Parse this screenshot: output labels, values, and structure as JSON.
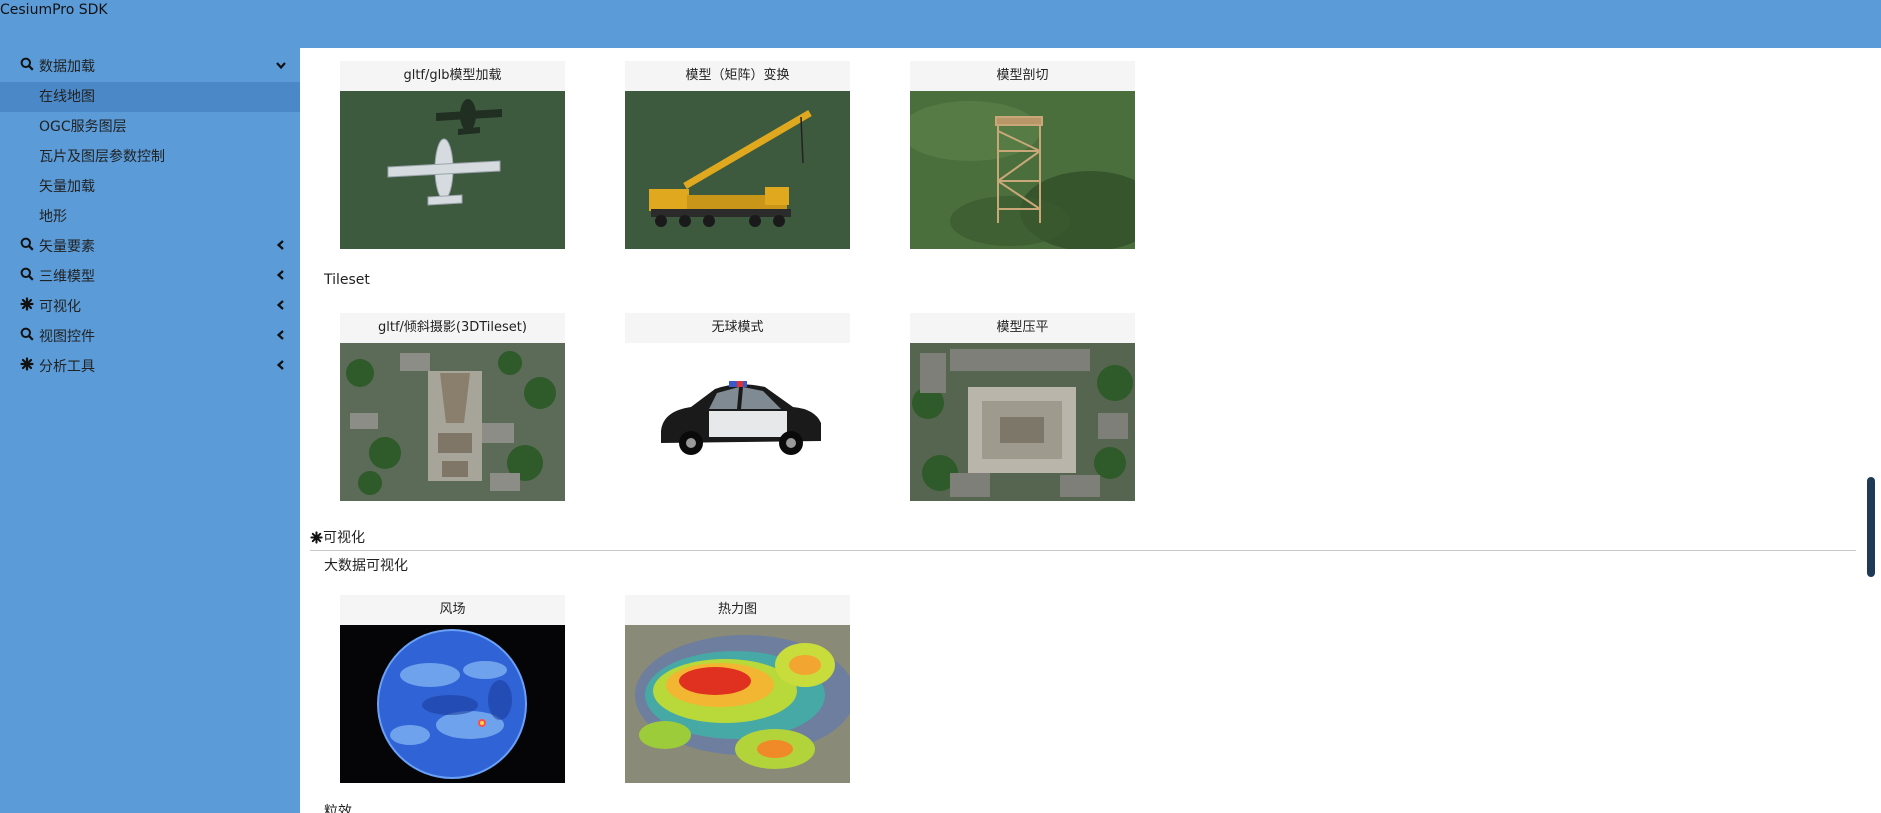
{
  "app": {
    "title": "CesiumPro SDK"
  },
  "sidebar": {
    "groups": [
      {
        "label": "数据加载",
        "icon": "search-icon",
        "expanded": true,
        "items": [
          "在线地图",
          "OGC服务图层",
          "瓦片及图层参数控制",
          "矢量加载",
          "地形"
        ]
      },
      {
        "label": "矢量要素",
        "icon": "search-icon",
        "expanded": false
      },
      {
        "label": "三维模型",
        "icon": "search-icon",
        "expanded": false
      },
      {
        "label": "可视化",
        "icon": "gear-icon",
        "expanded": false
      },
      {
        "label": "视图控件",
        "icon": "search-icon",
        "expanded": false
      },
      {
        "label": "分析工具",
        "icon": "gear-icon",
        "expanded": false
      }
    ],
    "active_item": "在线地图"
  },
  "main": {
    "cards_row1": [
      "gltf/glb模型加载",
      "模型（矩阵）变换",
      "模型剖切"
    ],
    "section_tileset": "Tileset",
    "cards_row2": [
      "gltf/倾斜摄影(3DTileset)",
      "无球模式",
      "模型压平"
    ],
    "category_visual": "可视化",
    "section_bigdata": "大数据可视化",
    "cards_row3": [
      "风场",
      "热力图"
    ],
    "section_partial": "粒效"
  },
  "colors": {
    "header": "#5a9bd8",
    "sidebar": "#5a9bd8",
    "active": "#4a88c7",
    "scrollbar": "#1f3a57"
  }
}
